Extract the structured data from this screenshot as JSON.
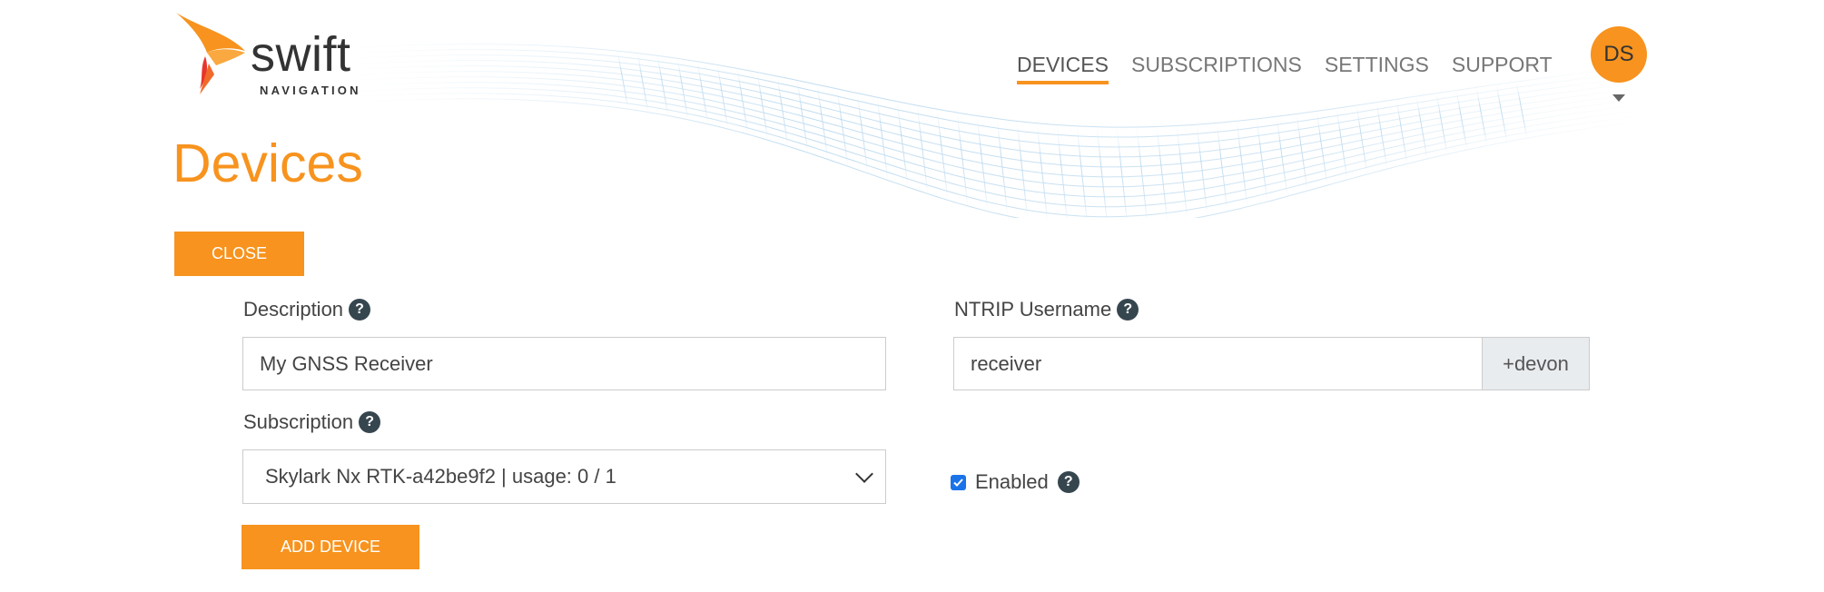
{
  "brand": {
    "wordmark": "swift",
    "tagline": "NAVIGATION",
    "colors": {
      "accent": "#f7931e",
      "accent_red": "#e8352b",
      "help_icon": "#36464f"
    }
  },
  "nav": {
    "items": [
      {
        "label": "DEVICES",
        "active": true
      },
      {
        "label": "SUBSCRIPTIONS",
        "active": false
      },
      {
        "label": "SETTINGS",
        "active": false
      },
      {
        "label": "SUPPORT",
        "active": false
      }
    ]
  },
  "user": {
    "initials": "DS"
  },
  "page": {
    "title": "Devices"
  },
  "buttons": {
    "close": "CLOSE",
    "add_device": "ADD DEVICE"
  },
  "form": {
    "description": {
      "label": "Description",
      "value": "My GNSS Receiver"
    },
    "subscription": {
      "label": "Subscription",
      "selected": "Skylark Nx RTK-a42be9f2 | usage: 0 / 1"
    },
    "ntrip_username": {
      "label": "NTRIP Username",
      "value": "receiver",
      "suffix": "+devon"
    },
    "enabled": {
      "label": "Enabled",
      "checked": true
    },
    "help_glyph": "?"
  },
  "icons": [
    "swift-logo-icon",
    "help-icon",
    "chevron-down-icon",
    "caret-down-icon",
    "checkbox-checked-icon"
  ]
}
